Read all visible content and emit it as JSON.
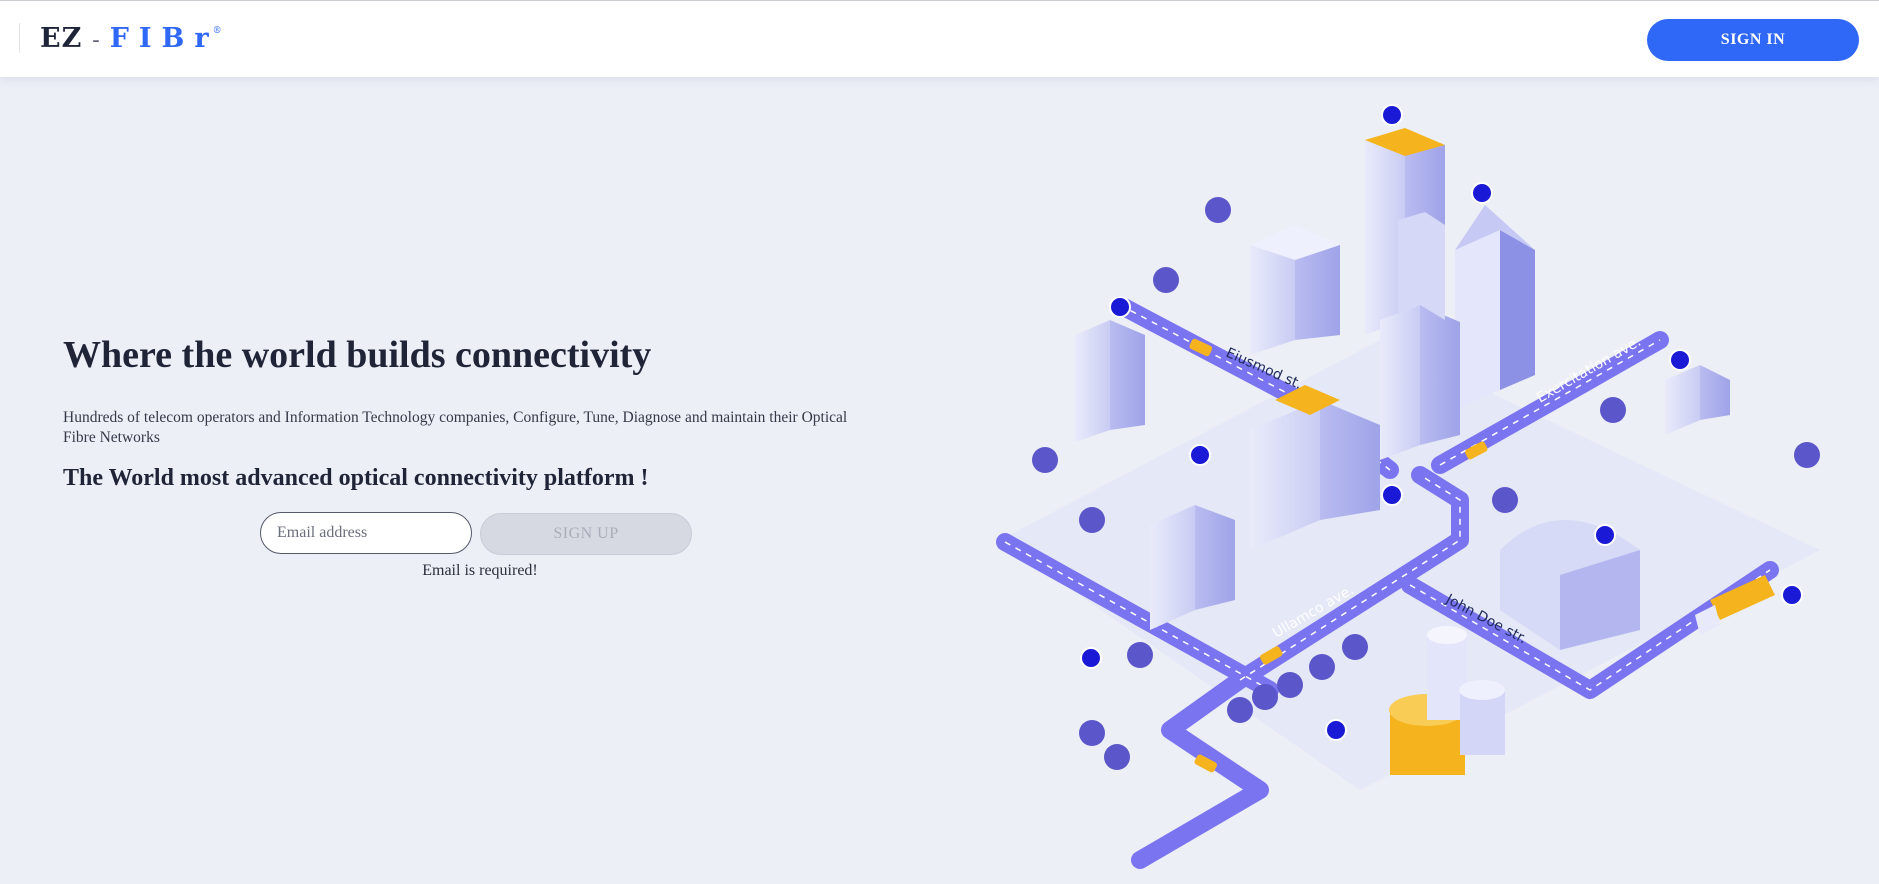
{
  "header": {
    "logo": {
      "part1": "EZ",
      "separator": "-",
      "part2": "FIBr",
      "registered": "®"
    },
    "signin_label": "SIGN IN"
  },
  "hero": {
    "title": "Where the world builds connectivity",
    "description": "Hundreds of telecom operators and Information Technology companies, Configure, Tune, Diagnose and maintain their Optical Fibre Networks",
    "subtitle": "The World most advanced optical connectivity platform !"
  },
  "form": {
    "email_placeholder": "Email address",
    "email_value": "",
    "signup_label": "SIGN UP",
    "error": "Email is required!"
  },
  "illustration": {
    "streets": [
      "Eiusmod st.",
      "Exercitation ave.",
      "Ullamco ave.",
      "John Doe str."
    ]
  },
  "colors": {
    "primary": "#2f67f6",
    "background": "#eceff6",
    "text": "#1f2537",
    "road": "#7b74f0",
    "accent_yellow": "#f5b41e"
  }
}
